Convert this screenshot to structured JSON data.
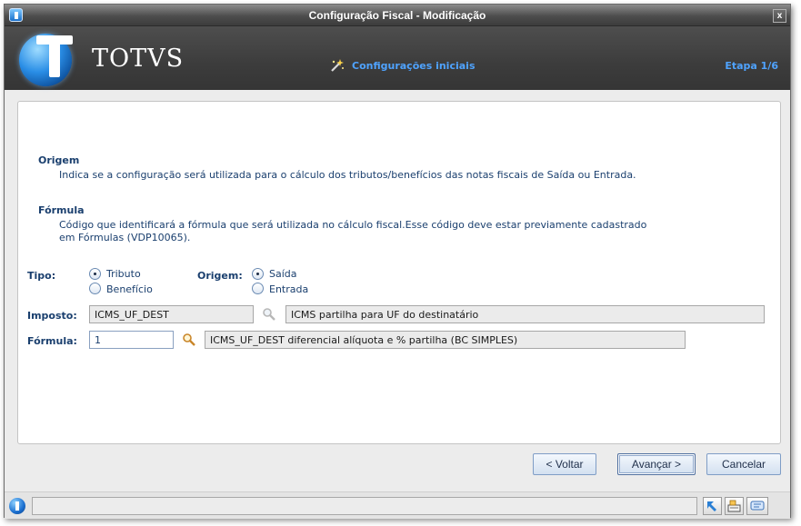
{
  "window": {
    "title": "Configuração Fiscal - Modificação",
    "close_label": "x"
  },
  "banner": {
    "brand": "TOTVS",
    "step_title": "Configurações iniciais",
    "step_count": "Etapa 1/6"
  },
  "help": {
    "origem_title": "Origem",
    "origem_text": "Indica se a configuração será utilizada para o cálculo dos tributos/benefícios das notas fiscais de Saída ou Entrada.",
    "formula_title": "Fórmula",
    "formula_text_1": "Código que identificará a fórmula que será utilizada no cálculo fiscal.Esse código deve estar previamente cadastrado",
    "formula_text_2": "em Fórmulas (VDP10065)."
  },
  "form": {
    "tipo_label": "Tipo:",
    "tipo_options": [
      {
        "label": "Tributo",
        "checked": true
      },
      {
        "label": "Benefício",
        "checked": false
      }
    ],
    "origem_label": "Origem:",
    "origem_options": [
      {
        "label": "Saída",
        "checked": true
      },
      {
        "label": "Entrada",
        "checked": false
      }
    ],
    "imposto_label": "Imposto:",
    "imposto_value": "ICMS_UF_DEST",
    "imposto_desc": "ICMS partilha para UF do destinatário",
    "formula_label": "Fórmula:",
    "formula_value": "1",
    "formula_desc": "ICMS_UF_DEST diferencial alíquota e % partilha (BC SIMPLES)"
  },
  "buttons": {
    "voltar": "< Voltar",
    "avancar": "Avançar >",
    "cancelar": "Cancelar"
  },
  "icons": {
    "window_logo": "totvs-logo-icon",
    "wizard": "magic-wand-icon",
    "lookup": "magnifier-icon",
    "status": [
      "resize-icon",
      "keyboard-icon",
      "chat-icon"
    ]
  },
  "colors": {
    "accent": "#4fa3ff",
    "label": "#1a3f6e",
    "banner": "#3c3c3c"
  }
}
